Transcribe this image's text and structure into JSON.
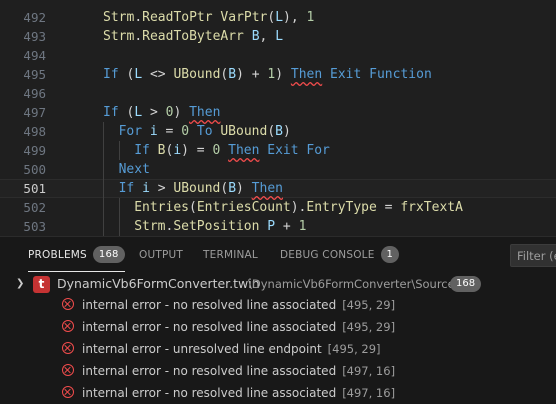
{
  "editor": {
    "lines": [
      {
        "n": "492",
        "tokens": [
          [
            "t-fn",
            "Strm"
          ],
          [
            "t-op",
            "."
          ],
          [
            "t-fn",
            "ReadToPtr"
          ],
          [
            "t-op",
            " "
          ],
          [
            "t-fn",
            "VarPtr"
          ],
          [
            "t-op",
            "("
          ],
          [
            "t-var",
            "L"
          ],
          [
            "t-op",
            "), "
          ],
          [
            "t-num",
            "1"
          ]
        ],
        "indent": 1,
        "current": false
      },
      {
        "n": "493",
        "tokens": [
          [
            "t-fn",
            "Strm"
          ],
          [
            "t-op",
            "."
          ],
          [
            "t-fn",
            "ReadToByteArr"
          ],
          [
            "t-op",
            " "
          ],
          [
            "t-var",
            "B"
          ],
          [
            "t-op",
            ", "
          ],
          [
            "t-var",
            "L"
          ]
        ],
        "indent": 1,
        "current": false
      },
      {
        "n": "494",
        "tokens": [],
        "indent": 1,
        "current": false
      },
      {
        "n": "495",
        "tokens": [
          [
            "t-kw",
            "If"
          ],
          [
            "t-op",
            " ("
          ],
          [
            "t-var",
            "L"
          ],
          [
            "t-op",
            " <> "
          ],
          [
            "t-fn",
            "UBound"
          ],
          [
            "t-op",
            "("
          ],
          [
            "t-var",
            "B"
          ],
          [
            "t-op",
            ") + "
          ],
          [
            "t-num",
            "1"
          ],
          [
            "t-op",
            ") "
          ],
          [
            "t-kwu",
            "Then"
          ],
          [
            "t-op",
            " "
          ],
          [
            "t-kw",
            "Exit"
          ],
          [
            "t-op",
            " "
          ],
          [
            "t-kw",
            "Function"
          ]
        ],
        "indent": 1,
        "current": false
      },
      {
        "n": "496",
        "tokens": [],
        "indent": 1,
        "current": false
      },
      {
        "n": "497",
        "tokens": [
          [
            "t-kw",
            "If"
          ],
          [
            "t-op",
            " ("
          ],
          [
            "t-var",
            "L"
          ],
          [
            "t-op",
            " > "
          ],
          [
            "t-num",
            "0"
          ],
          [
            "t-op",
            ") "
          ],
          [
            "t-kwu",
            "Then"
          ]
        ],
        "indent": 1,
        "current": false
      },
      {
        "n": "498",
        "tokens": [
          [
            "t-kw",
            "For"
          ],
          [
            "t-op",
            " "
          ],
          [
            "t-var",
            "i"
          ],
          [
            "t-op",
            " = "
          ],
          [
            "t-num",
            "0"
          ],
          [
            "t-op",
            " "
          ],
          [
            "t-kw",
            "To"
          ],
          [
            "t-op",
            " "
          ],
          [
            "t-fn",
            "UBound"
          ],
          [
            "t-op",
            "("
          ],
          [
            "t-var",
            "B"
          ],
          [
            "t-op",
            ")"
          ]
        ],
        "indent": 2,
        "current": false
      },
      {
        "n": "499",
        "tokens": [
          [
            "t-kw",
            "If"
          ],
          [
            "t-op",
            " "
          ],
          [
            "t-fn",
            "B"
          ],
          [
            "t-op",
            "("
          ],
          [
            "t-var",
            "i"
          ],
          [
            "t-op",
            ") = "
          ],
          [
            "t-num",
            "0"
          ],
          [
            "t-op",
            " "
          ],
          [
            "t-kwu",
            "Then"
          ],
          [
            "t-op",
            " "
          ],
          [
            "t-kw",
            "Exit"
          ],
          [
            "t-op",
            " "
          ],
          [
            "t-kw",
            "For"
          ]
        ],
        "indent": 3,
        "current": false
      },
      {
        "n": "500",
        "tokens": [
          [
            "t-kw",
            "Next"
          ]
        ],
        "indent": 2,
        "current": false
      },
      {
        "n": "501",
        "tokens": [
          [
            "t-kw",
            "If"
          ],
          [
            "t-op",
            " "
          ],
          [
            "t-var",
            "i"
          ],
          [
            "t-op",
            " > "
          ],
          [
            "t-fn",
            "UBound"
          ],
          [
            "t-op",
            "("
          ],
          [
            "t-var",
            "B"
          ],
          [
            "t-op",
            ") "
          ],
          [
            "t-kwu",
            "Then"
          ]
        ],
        "indent": 2,
        "current": true
      },
      {
        "n": "502",
        "tokens": [
          [
            "t-fn",
            "Entries"
          ],
          [
            "t-op",
            "("
          ],
          [
            "t-fn",
            "EntriesCount"
          ],
          [
            "t-op",
            ")."
          ],
          [
            "t-fn",
            "EntryType"
          ],
          [
            "t-op",
            " = "
          ],
          [
            "t-fn",
            "frxTextA"
          ]
        ],
        "indent": 3,
        "current": false
      },
      {
        "n": "503",
        "tokens": [
          [
            "t-fn",
            "Strm"
          ],
          [
            "t-op",
            "."
          ],
          [
            "t-fn",
            "SetPosition"
          ],
          [
            "t-op",
            " "
          ],
          [
            "t-var",
            "P"
          ],
          [
            "t-op",
            " + "
          ],
          [
            "t-num",
            "1"
          ]
        ],
        "indent": 3,
        "current": false
      }
    ]
  },
  "panel": {
    "tabs": [
      {
        "label": "PROBLEMS",
        "badge": "168",
        "active": true
      },
      {
        "label": "OUTPUT",
        "badge": null,
        "active": false
      },
      {
        "label": "TERMINAL",
        "badge": null,
        "active": false
      },
      {
        "label": "DEBUG CONSOLE",
        "badge": "1",
        "active": false
      }
    ],
    "filter_placeholder": "Filter (e",
    "file": {
      "icon_letter": "t",
      "name": "DynamicVb6FormConverter.twin",
      "path": "\\DynamicVb6FormConverter\\Sources",
      "count": "168"
    },
    "problems": [
      {
        "message": "internal error - no resolved line associated",
        "location": "[495, 29]"
      },
      {
        "message": "internal error - no resolved line associated",
        "location": "[495, 29]"
      },
      {
        "message": "internal error - unresolved line endpoint",
        "location": "[495, 29]"
      },
      {
        "message": "internal error - no resolved line associated",
        "location": "[497, 16]"
      },
      {
        "message": "internal error - no resolved line associated",
        "location": "[497, 16]"
      }
    ]
  },
  "colors": {
    "error": "#f14c4c",
    "keyword": "#569cd6",
    "function": "#dcdcaa",
    "number": "#b5cea8",
    "variable": "#9cdcfe"
  }
}
